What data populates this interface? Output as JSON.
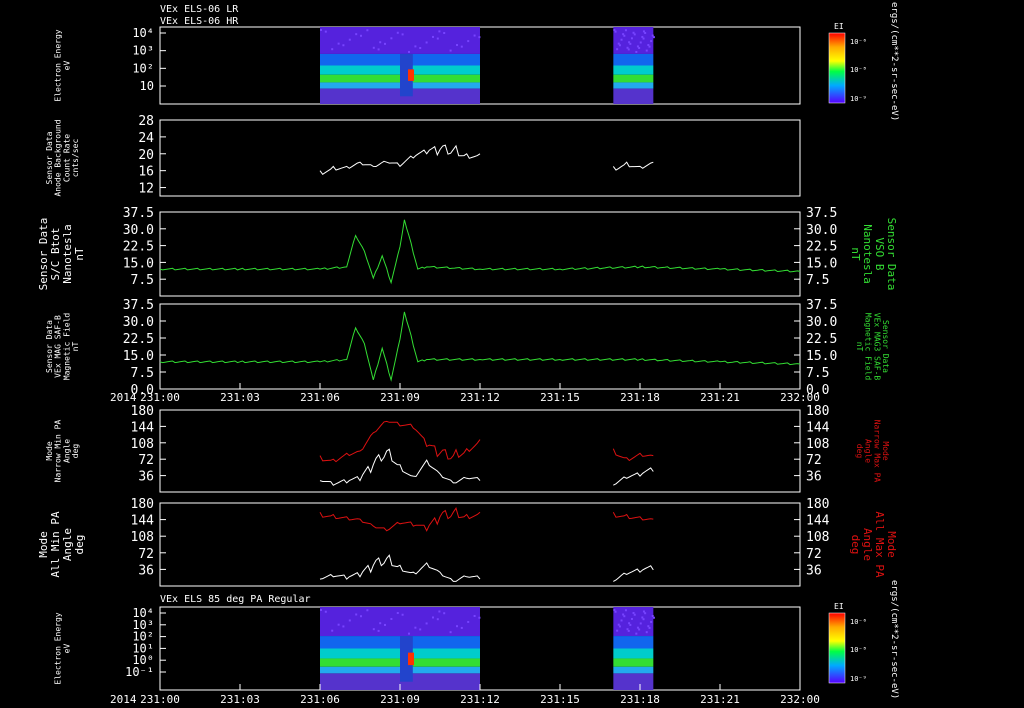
{
  "header": {
    "line1": "VEx ELS-06 LR",
    "line2": "VEx ELS-06 HR"
  },
  "bottom_title": "VEx ELS 85 deg PA Regular",
  "colorbar": {
    "label": "EI",
    "side_label": "ergs/(cm**2-sr-sec-eV)",
    "ticks": [
      "10⁻⁶",
      "10⁻⁸",
      "10⁻⁹"
    ]
  },
  "time_axis": {
    "year": "2014",
    "ticks": [
      "231:00",
      "231:03",
      "231:06",
      "231:09",
      "231:12",
      "231:15",
      "231:18",
      "231:21",
      "232:00"
    ]
  },
  "colors": {
    "frame": "#ffffff",
    "white_trace": "#ffffff",
    "green_trace": "#33dd33",
    "red_trace": "#dd1111",
    "background": "#000000"
  },
  "chart_data": [
    {
      "type": "heatmap",
      "ylabel": [
        "Electron Energy",
        "eV"
      ],
      "yticks": [
        "10",
        "10²",
        "10³",
        "10⁴"
      ],
      "zlabel": "EI",
      "data_intervals": [
        [
          "231:06:00",
          "231:12:00"
        ],
        [
          "231:17:00",
          "231:18:30"
        ]
      ]
    },
    {
      "type": "line",
      "ylabel": [
        "Sensor Data",
        "Anode Background",
        "Count Rate",
        "cnts/sec"
      ],
      "ylim": [
        10,
        28
      ],
      "yticks": [
        "12",
        "16",
        "20",
        "24",
        "28"
      ],
      "series": [
        {
          "color": "#ffffff",
          "segments": [
            {
              "x": [
                "231:06:00",
                "231:06:30",
                "231:07:00",
                "231:07:30",
                "231:08:00",
                "231:08:30",
                "231:09:00",
                "231:09:30",
                "231:10:00",
                "231:10:30",
                "231:11:00",
                "231:11:30",
                "231:12:00"
              ],
              "values": [
                16,
                17,
                17,
                18,
                17,
                18,
                17,
                19,
                20,
                21,
                21,
                20,
                20
              ]
            },
            {
              "x": [
                "231:17:00",
                "231:17:30",
                "231:18:00",
                "231:18:30"
              ],
              "values": [
                17,
                18,
                17,
                18
              ]
            }
          ]
        }
      ]
    },
    {
      "type": "line",
      "ylabel": [
        "Sensor Data",
        "S/C Btot",
        "Nanotesla",
        "nT"
      ],
      "ylabel_right": [
        "Sensor Data",
        "VSO B",
        "Nanotesla",
        "nT"
      ],
      "ylim": [
        0,
        37.5
      ],
      "yticks": [
        "7.5",
        "15.0",
        "22.5",
        "30.0",
        "37.5"
      ],
      "series": [
        {
          "color": "#33dd33",
          "x": [
            "231:00:00",
            "231:03:00",
            "231:06:00",
            "231:07:00",
            "231:07:20",
            "231:07:40",
            "231:08:00",
            "231:08:20",
            "231:08:40",
            "231:09:00",
            "231:09:10",
            "231:09:20",
            "231:09:40",
            "231:10:00",
            "231:12:00",
            "231:15:00",
            "231:18:00",
            "231:21:00",
            "232:00:00"
          ],
          "values": [
            12,
            12,
            12,
            13,
            27,
            20,
            8,
            18,
            6,
            22,
            34,
            27,
            12,
            13,
            12,
            12,
            13,
            12,
            11
          ]
        }
      ]
    },
    {
      "type": "line",
      "ylabel": [
        "Sensor Data",
        "VEx MAG SAF-B",
        "Magnetic Field",
        "nT"
      ],
      "ylabel_right": [
        "Sensor Data",
        "VEx MAG3 SAF-B",
        "Magnetic Field",
        "nT"
      ],
      "ylim": [
        0,
        37.5
      ],
      "yticks": [
        "0.0",
        "7.5",
        "15.0",
        "22.5",
        "30.0",
        "37.5"
      ],
      "series": [
        {
          "color": "#33dd33",
          "x": [
            "231:00:00",
            "231:03:00",
            "231:06:00",
            "231:07:00",
            "231:07:20",
            "231:07:40",
            "231:08:00",
            "231:08:20",
            "231:08:40",
            "231:09:00",
            "231:09:10",
            "231:09:20",
            "231:09:40",
            "231:10:00",
            "231:12:00",
            "231:15:00",
            "231:18:00",
            "231:21:00",
            "232:00:00"
          ],
          "values": [
            12,
            12,
            12,
            13,
            27,
            20,
            4,
            18,
            4,
            22,
            34,
            27,
            12,
            13,
            13,
            13,
            13,
            12,
            11
          ]
        }
      ]
    },
    {
      "type": "line",
      "ylabel": [
        "Mode",
        "Narrow Min PA",
        "Angle",
        "deg"
      ],
      "ylabel_right": [
        "Mode",
        "Narrow Max PA",
        "Angle",
        "deg"
      ],
      "ylim": [
        0,
        180
      ],
      "yticks": [
        "36",
        "72",
        "108",
        "144",
        "180"
      ],
      "series": [
        {
          "color": "#dd1111",
          "segments": [
            {
              "x": [
                "231:06:00",
                "231:06:30",
                "231:07:00",
                "231:07:30",
                "231:08:00",
                "231:08:30",
                "231:09:00",
                "231:09:30",
                "231:10:00",
                "231:10:30",
                "231:11:00",
                "231:11:30",
                "231:12:00"
              ],
              "values": [
                80,
                72,
                85,
                90,
                130,
                155,
                145,
                140,
                100,
                85,
                80,
                95,
                115
              ]
            },
            {
              "x": [
                "231:17:00",
                "231:17:30",
                "231:18:00",
                "231:18:30"
              ],
              "values": [
                95,
                75,
                85,
                80
              ]
            }
          ]
        },
        {
          "color": "#ffffff",
          "segments": [
            {
              "x": [
                "231:06:00",
                "231:06:30",
                "231:07:00",
                "231:07:30",
                "231:08:00",
                "231:08:30",
                "231:09:00",
                "231:09:30",
                "231:10:00",
                "231:10:30",
                "231:11:00",
                "231:11:30",
                "231:12:00"
              ],
              "values": [
                25,
                15,
                20,
                25,
                60,
                90,
                60,
                35,
                70,
                40,
                20,
                30,
                25
              ]
            },
            {
              "x": [
                "231:17:00",
                "231:17:30",
                "231:18:00",
                "231:18:30"
              ],
              "values": [
                15,
                30,
                35,
                45
              ]
            }
          ]
        }
      ]
    },
    {
      "type": "line",
      "ylabel": [
        "Mode",
        "All Min PA",
        "Angle",
        "deg"
      ],
      "ylabel_right": [
        "Mode",
        "All Max PA",
        "Angle",
        "deg"
      ],
      "ylim": [
        0,
        180
      ],
      "yticks": [
        "36",
        "72",
        "108",
        "144",
        "180"
      ],
      "series": [
        {
          "color": "#dd1111",
          "segments": [
            {
              "x": [
                "231:06:00",
                "231:06:30",
                "231:07:00",
                "231:07:30",
                "231:08:00",
                "231:08:30",
                "231:09:00",
                "231:09:30",
                "231:10:00",
                "231:10:30",
                "231:11:00",
                "231:11:30",
                "231:12:00"
              ],
              "values": [
                160,
                155,
                150,
                145,
                130,
                120,
                135,
                130,
                120,
                150,
                160,
                155,
                160
              ]
            },
            {
              "x": [
                "231:17:00",
                "231:17:30",
                "231:18:00",
                "231:18:30"
              ],
              "values": [
                160,
                155,
                150,
                145
              ]
            }
          ]
        },
        {
          "color": "#ffffff",
          "segments": [
            {
              "x": [
                "231:06:00",
                "231:06:30",
                "231:07:00",
                "231:07:30",
                "231:08:00",
                "231:08:30",
                "231:09:00",
                "231:09:30",
                "231:10:00",
                "231:10:30",
                "231:11:00",
                "231:11:30",
                "231:12:00"
              ],
              "values": [
                15,
                20,
                15,
                20,
                45,
                60,
                45,
                30,
                50,
                30,
                10,
                20,
                15
              ]
            },
            {
              "x": [
                "231:17:00",
                "231:17:30",
                "231:18:00",
                "231:18:30"
              ],
              "values": [
                10,
                25,
                30,
                35
              ]
            }
          ]
        }
      ]
    },
    {
      "type": "heatmap",
      "ylabel": [
        "Electron Energy",
        "eV"
      ],
      "yticks": [
        "10⁻¹",
        "10⁰",
        "10¹",
        "10²",
        "10³",
        "10⁴"
      ],
      "zlabel": "EI",
      "data_intervals": [
        [
          "231:06:00",
          "231:12:00"
        ],
        [
          "231:17:00",
          "231:18:30"
        ]
      ]
    }
  ]
}
